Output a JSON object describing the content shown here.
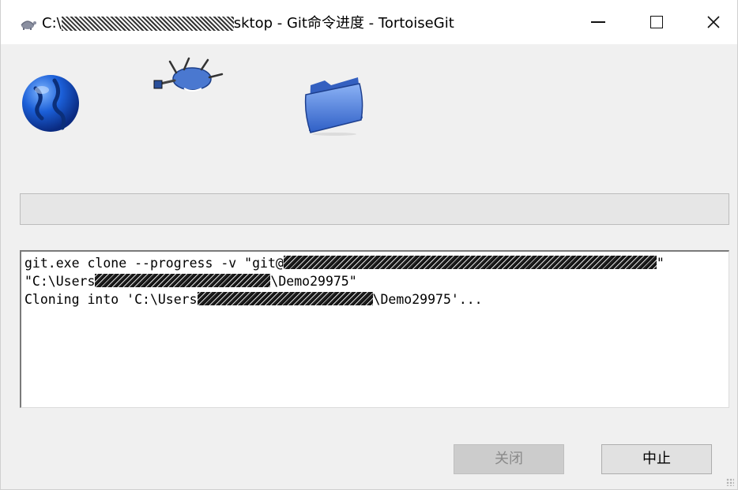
{
  "window": {
    "title_prefix": "C:\\",
    "title_suffix": "sktop - Git命令进度 - TortoiseGit",
    "controls": {
      "minimize": "—",
      "maximize": "☐",
      "close": "✕"
    }
  },
  "animation": {
    "icons": [
      "globe-icon",
      "tortoise-icon",
      "folder-icon"
    ]
  },
  "progress": {
    "fraction": 0.0
  },
  "log": {
    "line1_prefix": "git.exe clone --progress -v \"git@",
    "line1_suffix": "\"",
    "line2_prefix": "\"C:\\Users",
    "line2_suffix": "\\Demo29975\"",
    "line3_prefix": "Cloning into 'C:\\Users",
    "line3_suffix": "\\Demo29975'..."
  },
  "buttons": {
    "close_label": "关闭",
    "abort_label": "中止"
  },
  "colors": {
    "window_bg": "#f0f0f0",
    "progress_fill": "#06b025"
  }
}
